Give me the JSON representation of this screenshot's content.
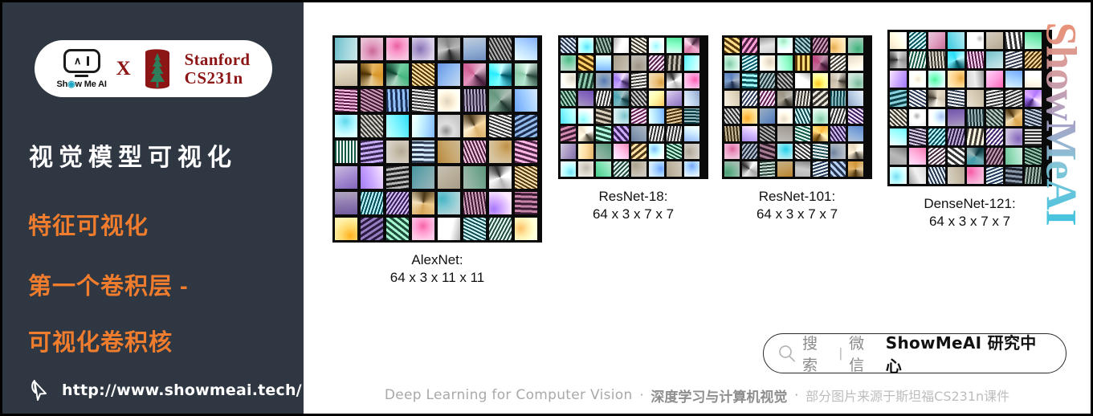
{
  "sidebar": {
    "logo": {
      "showmeai_label": "Show Me AI",
      "cross": "X",
      "stanford_line1": "Stanford",
      "stanford_line2": "CS231n",
      "smai_caret": "∧",
      "smai_bar": "I"
    },
    "title": "视觉模型可视化",
    "heading1": "特征可视化",
    "heading2": "第一个卷积层 -",
    "heading3": "可视化卷积核",
    "url": "http://www.showmeai.tech/",
    "accent_color": "#F07C2E",
    "background_color": "#2F3742"
  },
  "main": {
    "watermark": "ShowMeAI",
    "figures": [
      {
        "name": "AlexNet",
        "caption_name": "AlexNet:",
        "caption_dims": "64 x 3 x 11 x 11",
        "rows": 8,
        "cols": 8
      },
      {
        "name": "ResNet-18",
        "caption_name": "ResNet-18:",
        "caption_dims": "64 x 3 x 7 x 7",
        "rows": 8,
        "cols": 8
      },
      {
        "name": "ResNet-101",
        "caption_name": "ResNet-101:",
        "caption_dims": "64 x 3 x 7 x 7",
        "rows": 8,
        "cols": 8
      },
      {
        "name": "DenseNet-121",
        "caption_name": "DenseNet-121:",
        "caption_dims": "64 x 3 x 7 x 7",
        "rows": 8,
        "cols": 8
      }
    ],
    "search": {
      "icon": "search-icon",
      "label": "搜索",
      "separator": "|",
      "channel": "微信",
      "account": "ShowMeAI 研究中心"
    },
    "footer": {
      "english": "Deep Learning for Computer Vision",
      "dot1": "·",
      "chinese_bold": "深度学习与计算机视觉",
      "dot2": "·",
      "chinese_note": "部分图片来源于斯坦福CS231n课件"
    }
  }
}
